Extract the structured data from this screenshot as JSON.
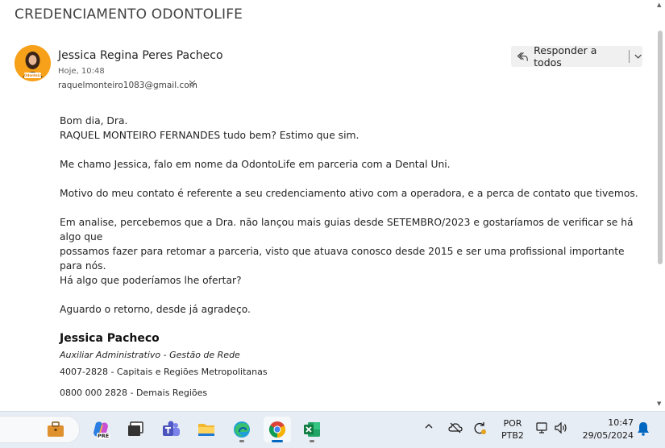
{
  "email": {
    "subject": "CREDENCIAMENTO ODONTOLIFE",
    "sender_name": "Jessica Regina Peres Pacheco",
    "sent_time": "Hoje, 10:48",
    "recipient": "raquelmonteiro1083@gmail.com",
    "avatar_logo_text": "OdontoLife",
    "reply_all_label": "Responder a todos",
    "body": {
      "greeting": "Bom dia, Dra.",
      "line2": "RAQUEL MONTEIRO FERNANDES tudo bem? Estimo que sim.",
      "p2": "Me chamo Jessica, falo em nome da OdontoLife em parceria com a Dental Uni.",
      "p3": "Motivo do meu contato é referente a seu credenciamento ativo  com a operadora, e a perca de contato que tivemos.",
      "p4_line1": "Em analise, percebemos que a Dra. não lançou mais guias desde SETEMBRO/2023 e gostaríamos de verificar se há algo que",
      "p4_line2": "possamos fazer para retomar a parceria, visto que atuava conosco desde 2015 e ser uma profissional importante para nós.",
      "p4_line3": "Há algo que poderíamos lhe ofertar?",
      "p5": "Aguardo o retorno, desde já agradeço."
    },
    "signature": {
      "name": "Jessica Pacheco",
      "role": "Auxiliar Administrativo - Gestão de Rede",
      "phone1": "4007-2828 - Capitais e Regiões Metropolitanas",
      "phone2": "0800 000 2828 - Demais Regiões"
    }
  },
  "taskbar": {
    "apps": [
      {
        "name": "copilot",
        "badge": "PRE"
      },
      {
        "name": "task-view"
      },
      {
        "name": "teams"
      },
      {
        "name": "file-explorer"
      },
      {
        "name": "edge"
      },
      {
        "name": "chrome"
      },
      {
        "name": "excel"
      }
    ],
    "language": "POR",
    "keyboard": "PTB2",
    "time": "10:47",
    "date": "29/05/2024"
  },
  "colors": {
    "accent": "#0067c0",
    "avatar_bg": "#f7a11a",
    "taskbar_bg": "#e7edf4"
  }
}
